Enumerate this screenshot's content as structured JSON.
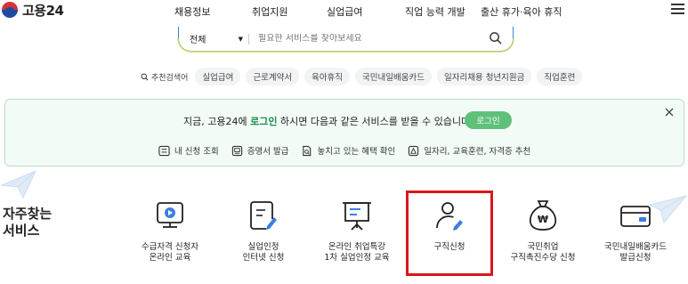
{
  "header": {
    "logo_text": "고용24",
    "nav": [
      "채용정보",
      "취업지원",
      "실업급여",
      "직업 능력 개발",
      "출산 휴가·육아 휴직"
    ]
  },
  "search": {
    "scope": "전체",
    "placeholder": "필요한 서비스를 찾아보세요"
  },
  "recommended": {
    "label": "추천검색어",
    "tags": [
      "실업급여",
      "근로계약서",
      "육아휴직",
      "국민내일배움카드",
      "일자리채용 청년지원금",
      "직업훈련"
    ]
  },
  "login_panel": {
    "message_pre": "지금, 고용24에 ",
    "message_link": "로그인",
    "message_post": " 하시면 다음과 같은 서비스를 받을 수 있습니다.",
    "button": "로그인",
    "services": [
      "내 신청 조회",
      "증명서 발급",
      "놓치고 있는 혜택 확인",
      "일자리, 교육훈련, 자격증 추천"
    ]
  },
  "frequent": {
    "title_line1": "자주찾는",
    "title_line2": "서비스",
    "items": [
      {
        "line1": "수급자격 신청자",
        "line2": "온라인 교육",
        "icon": "video-play-icon"
      },
      {
        "line1": "실업인정",
        "line2": "인터넷 신청",
        "icon": "document-pen-icon"
      },
      {
        "line1": "온라인 취업특강",
        "line2": "1차 실업인정 교육",
        "icon": "presentation-board-icon"
      },
      {
        "line1": "구직신청",
        "line2": "",
        "icon": "person-pen-icon"
      },
      {
        "line1": "국민취업",
        "line2": "구직촉진수당 신청",
        "icon": "money-bag-icon"
      },
      {
        "line1": "국민내일배움카드",
        "line2": "발급신청",
        "icon": "card-icon"
      }
    ]
  },
  "colors": {
    "brand_blue": "#3d7ee0",
    "green": "#5fc07a",
    "highlight_red": "#d9171d"
  }
}
